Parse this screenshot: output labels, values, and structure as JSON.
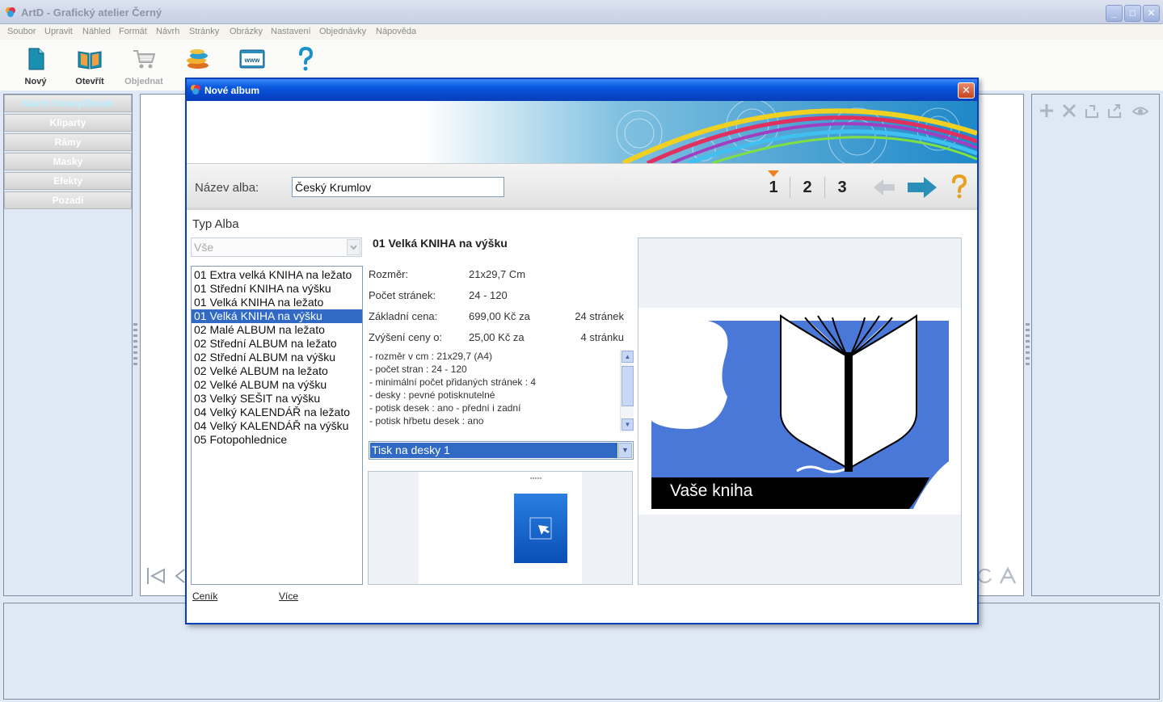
{
  "window": {
    "title": "ArtD - Grafický atelier Černý",
    "buttons": {
      "minimize": "_",
      "maximize": "□",
      "close": "✕"
    }
  },
  "menu": [
    "Soubor",
    "Upravit",
    "Náhled",
    "Formát",
    "Návrh",
    "Stránky",
    "Obrázky",
    "Nastavení",
    "Objednávky",
    "Nápověda"
  ],
  "toolbar": {
    "new_label": "Nový",
    "open_label": "Otevřít",
    "order_label": "Objednat",
    "www_text": "www"
  },
  "left_panel": {
    "items": [
      "Návrh Strany/Desek",
      "Kliparty",
      "Rámy",
      "Masky",
      "Efekty",
      "Pozadí"
    ]
  },
  "dialog": {
    "title": "Nové album",
    "close": "✕",
    "name_label": "Název alba:",
    "name_value": "Český Krumlov",
    "steps": [
      "1",
      "2",
      "3"
    ],
    "help": "?",
    "type_label": "Typ Alba",
    "type_filter": "Vše",
    "album_types": [
      "01 Extra velká KNIHA na ležato",
      "01 Střední KNIHA na výšku",
      "01 Velká KNIHA na ležato",
      "01 Velká KNIHA na výšku",
      "02 Malé ALBUM na ležato",
      "02 Střední ALBUM na ležato",
      "02 Střední ALBUM na výšku",
      "02 Velké ALBUM na ležato",
      "02 Velké ALBUM na výšku",
      "03 Velký SEŠIT na výšku",
      "04 Velký KALENDÁŘ na ležato",
      "04 Velký KALENDÁŘ na výšku",
      "05 Fotopohlednice"
    ],
    "selected_index": 3,
    "detail": {
      "title": "01 Velká KNIHA na výšku",
      "size_label": "Rozměr:",
      "size_value": "21x29,7 Cm",
      "pages_label": "Počet stránek:",
      "pages_value": "24 - 120",
      "price_label": "Základní cena:",
      "price_value": "699,00 Kč za",
      "price_extra": "24 stránek",
      "increase_label": "Zvýšení ceny o:",
      "increase_value": "25,00 Kč za",
      "increase_extra": "4 stránku",
      "description": [
        "- rozměr v cm : 21x29,7 (A4)",
        "- počet stran : 24 - 120",
        "- minimální počet přidaných stránek : 4",
        "- desky : pevné potisknutelné",
        "- potisk desek : ano - přední i zadní",
        "- potisk hřbetu desek : ano"
      ],
      "print_option": "Tisk na desky 1",
      "preview_caption": "Vaše kniha"
    },
    "links": {
      "pricelist": "Ceník",
      "more": "Více"
    }
  },
  "colors": {
    "accent": "#0a3fb8",
    "selection": "#316ac5",
    "arrow": "#2a8fb8",
    "help": "#e8a020",
    "preview_blue": "#4a78d8"
  }
}
